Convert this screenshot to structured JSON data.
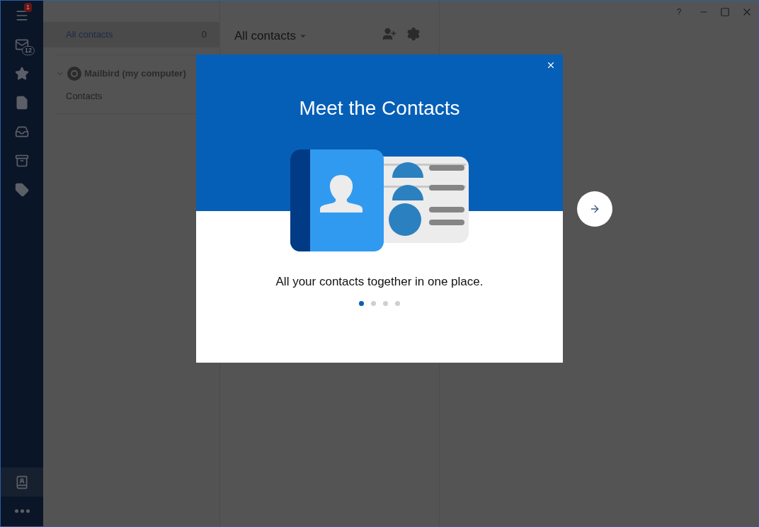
{
  "window": {
    "help": "?"
  },
  "rail": {
    "top": [
      {
        "kind": "menu",
        "badge": "1"
      },
      {
        "kind": "inbox",
        "badge": "12"
      },
      {
        "kind": "star"
      },
      {
        "kind": "draft"
      },
      {
        "kind": "outbox"
      },
      {
        "kind": "archive"
      },
      {
        "kind": "tags"
      }
    ],
    "bottom": [
      {
        "kind": "contacts",
        "selected": true
      },
      {
        "kind": "more",
        "selected": false
      }
    ]
  },
  "groups": {
    "all": {
      "label": "All contacts",
      "count": "0",
      "selected": true
    },
    "account": {
      "name": "Mailbird (my computer)",
      "expanded": true,
      "children": [
        {
          "label": "Contacts",
          "selected": false
        }
      ]
    }
  },
  "toolbar": {
    "title": "All contacts"
  },
  "dialog": {
    "title": "Meet the Contacts",
    "text": "All your contacts together in one place.",
    "pages": [
      {
        "selected": true
      },
      {
        "selected": false
      },
      {
        "selected": false
      },
      {
        "selected": false
      }
    ]
  }
}
